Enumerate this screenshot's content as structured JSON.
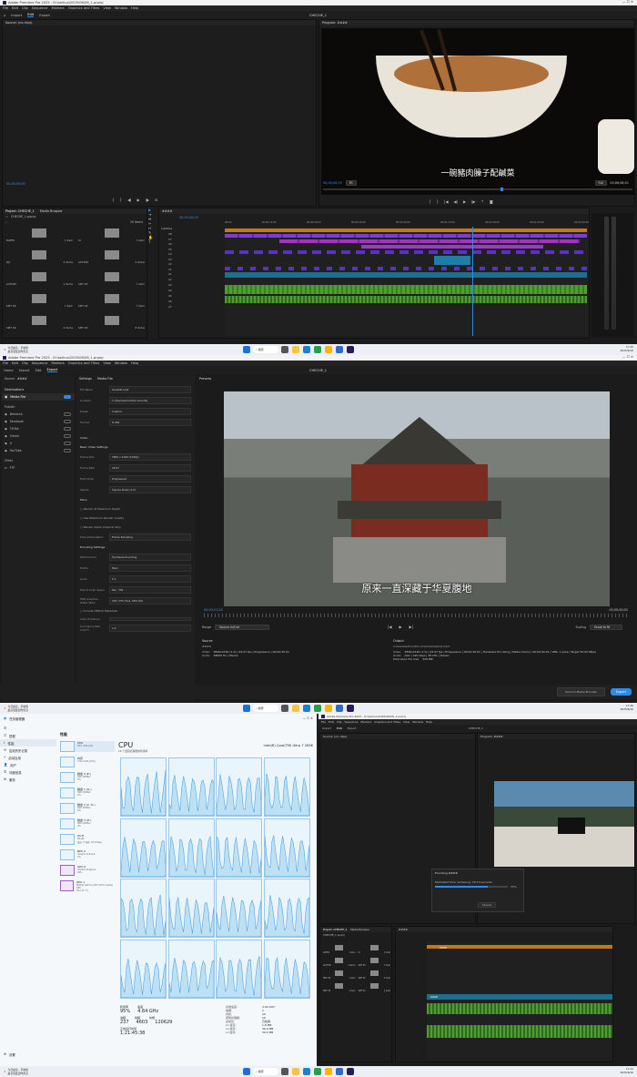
{
  "colors": {
    "accent": "#2d8ceb",
    "video": "#8a2be2",
    "audio": "#3e8f2a",
    "orange": "#c8761a"
  },
  "s1": {
    "app_title": "Adobe Premiere Pro 2025 - D:\\beihuo\\2025\\06\\06_1.prproj",
    "menu": [
      "File",
      "Edit",
      "Clip",
      "Sequence",
      "Markers",
      "Graphics and Titles",
      "View",
      "Window",
      "Help"
    ],
    "tabs": [
      "Import",
      "Edit",
      "Export"
    ],
    "center_title": "CHECHE_1",
    "source_label": "Source: (no clips)",
    "program_label": "Program: ####",
    "subtitle": "一碗豬肉臊子配鹹菜",
    "tc_left": "00;00;00;00",
    "tc_program": "00;00;40;29",
    "tc_program_end": "00;06;08;01",
    "fit": "Fit",
    "full": "Full",
    "project_tab": "Project: CHECHE_1",
    "media_browser": "Media Browser",
    "project_file": "CHECHE_1.prproj",
    "item_count": "10 Items",
    "bins": [
      [
        "DATES",
        "1 item",
        "IU",
        "1 item"
      ],
      [
        "DJI",
        "2 items",
        "ACTION",
        "2 items"
      ],
      [
        "ACTION",
        "1 items",
        "SMT 05",
        "1 item"
      ],
      [
        "SMT 06",
        "1 item",
        "SMT 04",
        "1 item"
      ],
      [
        "SMT 09",
        "2 items",
        "SMT 03",
        "8 items"
      ]
    ],
    "sequence_tab": "####",
    "tc_timeline": "00;00;40;29",
    "ruler": [
      "00;00",
      "00;00;15;00",
      "00;00;30;00",
      "00;00;45;00",
      "00;01;00;00",
      "00;01;15;00",
      "00;01;30;00",
      "00;01;45;00",
      "00;02;00;00"
    ],
    "tracks_v": [
      "V8",
      "V7",
      "V6",
      "V5",
      "V4",
      "V3",
      "V2",
      "V1"
    ],
    "tracks_a": [
      "A1",
      "A2",
      "A3",
      "A4",
      "A5",
      "A6",
      "A7"
    ],
    "subtitle_track": "Subtitles"
  },
  "taskbar1": {
    "weather": "今日最高，平常值",
    "weather2": "最高温度比昨天高",
    "search": "搜索",
    "time": "17:40",
    "date": "2025/6/16"
  },
  "s2": {
    "app_title": "Adobe Premiere Pro 2025 - D:\\beihuo\\2025\\06\\06_1.prproj",
    "menu": [
      "File",
      "Edit",
      "Clip",
      "Sequence",
      "Markers",
      "Graphics and Titles",
      "View",
      "Window",
      "Help"
    ],
    "tabs": [
      "Home",
      "Import",
      "Edit",
      "Export"
    ],
    "center_title": "CHECHE_1",
    "source": "Source",
    "source_name": "####",
    "destinations": "Destinations",
    "media_file": "Media File",
    "publish": "Publish",
    "publish_items": [
      "Behance",
      "Facebook",
      "TikTok",
      "Vimeo",
      "X",
      "YouTube"
    ],
    "other": "Other",
    "ftp": "FTP",
    "settings": "Settings",
    "media_file_title": "Media File",
    "file_name_lbl": "File Name",
    "file_name": "sheahat.mp4",
    "location_lbl": "Location",
    "location": "C:\\Users\\admin\\Documents\\",
    "preset_lbl": "Preset",
    "preset": "Custom",
    "format_lbl": "Format",
    "format": "H.264",
    "video": "Video",
    "basic_video": "Basic Video Settings",
    "match_source": "Match Source",
    "frame_size_lbl": "Frame Size",
    "frame_size": "3840 x 2160 (2160p)",
    "frame_rate_lbl": "Frame Rate",
    "frame_rate": "29.97",
    "field_order_lbl": "Field Order",
    "field_order": "Progressive",
    "aspect_lbl": "Aspect",
    "aspect": "Square Pixels (1.0)",
    "more": "More",
    "render_max_depth": "Render at Maximum Depth",
    "use_max_render": "Use Maximum Render Quality",
    "render_alpha": "Render Alpha Channel Only",
    "time_interp_lbl": "Time Interpolation",
    "time_interp": "Frame Sampling",
    "encoding_settings": "Encoding Settings",
    "performance_lbl": "Performance",
    "performance": "Hardware Encoding",
    "profile_lbl": "Profile",
    "profile": "Main",
    "level_lbl": "Level",
    "level": "5.1",
    "export_color_lbl": "Export Color Space",
    "export_color": "Rec. 709",
    "hdr_lbl": "HDR Graphics White (Nits)",
    "hdr": "203 (75% HLG, 58% PQ)",
    "include_metadata": "Include HDR10 Metadata",
    "color_primaries_lbl": "Color Primaries",
    "luminance_lbl": "Luminance Max (cd/m²)",
    "luminance": "1.0",
    "preview": "Preview",
    "subtitle": "原来一直深藏于华夏腹地",
    "tc_left": "00;00;21;28",
    "tc_right": "00;00;00;01",
    "range_lbl": "Range",
    "range": "Source In/Out",
    "scaling_lbl": "Scaling",
    "scaling": "Scale to fit",
    "source_title": "Source",
    "source_clip": "####",
    "source_video_lbl": "Video",
    "source_video": "3840x2160 (1.0) | 29.97 fps | Progressive | 00;00;30;01",
    "source_audio_lbl": "Audio",
    "source_audio": "48000 Hz | Stereo",
    "output_title": "Output",
    "output_path": "C:\\Users\\admin\\Documents\\sheahat.mp4",
    "output_video_lbl": "Video",
    "output_video": "3840x2160 (1.0) | 29.97 fps | Progressive | 00;00;30;01 | Hardware Encoding | Media Cache | 00;00;00;01 | VBR, 1 pass | Target 50.00 Mbps",
    "output_audio_lbl": "Audio",
    "output_audio": "AAC | 320 kbps | 48 kHz | Stereo",
    "est_size_lbl": "Estimated File Size",
    "est_size": "328 MB",
    "send_media_encoder": "Send to Media Encoder",
    "export_btn": "Export"
  },
  "taskbar2": {
    "weather": "今日最高，平常值",
    "weather2": "最高温度比昨天高",
    "search": "搜索",
    "time": "17:40",
    "date": "2025/6/16"
  },
  "tm": {
    "title": "任务管理器",
    "nav": [
      "进程",
      "性能",
      "应用历史记录",
      "启动应用",
      "用户",
      "详细信息",
      "服务"
    ],
    "settings": "设置",
    "perf": "性能",
    "items": [
      {
        "name": "CPU",
        "sub": "95% 4.84 GHz"
      },
      {
        "name": "内存",
        "sub": "7/31.6 GB (23%)"
      },
      {
        "name": "磁盘 0 (E:)",
        "sub": "SSD (NVMe)\n0%"
      },
      {
        "name": "磁盘 1 (G:)",
        "sub": "SSD (NVMe)\n0%"
      },
      {
        "name": "磁盘 2 (C: D:)",
        "sub": "SSD (NVMe)\n0%"
      },
      {
        "name": "磁盘 3 (H:)",
        "sub": "SSD (NVMe)\n0%"
      },
      {
        "name": "Wi-Fi",
        "sub": "WLAN\n发送: 0 接收: 18.9 Kbps"
      },
      {
        "name": "NPU 0",
        "sub": "Intel(R) AI Boost\n0%"
      },
      {
        "name": "GPU 0",
        "sub": "Intel(R) Graphics\n29%"
      },
      {
        "name": "GPU 1",
        "sub": "NVIDIA GeForce RTX 5070 Laptop GPU\n9% (41 °C)"
      }
    ],
    "cpu_title": "CPU",
    "cpu_model": "Intel(R) Core(TM) Ultra 7 265K",
    "cpu_caption": "16 个逻辑处理器的利用率",
    "util_lbl": "利用率",
    "util": "95%",
    "speed_lbl": "速度",
    "speed": "4.84 GHz",
    "proc_lbl": "进程",
    "proc": "237",
    "threads_lbl": "线程",
    "threads": "4603",
    "handles_lbl": "句柄",
    "handles": "120629",
    "uptime_lbl": "正常运行时间",
    "uptime": "1:21:45:38",
    "base_speed_lbl": "基准速度:",
    "base_speed": "3.90 GHz",
    "sockets_lbl": "插槽:",
    "sockets": "1",
    "cores_lbl": "内核:",
    "cores": "20",
    "lps_lbl": "逻辑处理器:",
    "lps": "20",
    "virt_lbl": "虚拟化:",
    "virt": "已启用",
    "l1_lbl": "L1 缓存:",
    "l1": "1.8 MB",
    "l2_lbl": "L2 缓存:",
    "l2": "36.0 MB",
    "l3_lbl": "L3 缓存:",
    "l3": "30.0 MB"
  },
  "s3": {
    "app_title": "Adobe Premiere Pro 2025 - D:\\beihuo\\2025\\06\\06_1.prproj",
    "menu": [
      "File",
      "Edit",
      "Clip",
      "Sequence",
      "Markers",
      "Graphics and Titles",
      "View",
      "Window",
      "Help"
    ],
    "tabs": [
      "Import",
      "Edit",
      "Export"
    ],
    "center_title": "CHECHE_1",
    "source_label": "Source: (no clips)",
    "program_label": "Program: ####",
    "encoding_title": "Encoding ####",
    "encoding_msg": "Estimated time remaining: 00:10 seconds",
    "encoding_pct": "72%",
    "cancel": "Cancel",
    "project_tab": "Project: CHECHE_1",
    "media_browser": "Media Browser",
    "project_file": "CHECHE_1.prproj",
    "bins": [
      [
        "DATES",
        "1 item",
        "IU",
        "1 item"
      ],
      [
        "ACTION",
        "1 items",
        "SMT 05",
        "1 item"
      ],
      [
        "SMT 06",
        "1 item",
        "SMT 04",
        "1 item"
      ],
      [
        "SMT 09",
        "1 item",
        "SMT 03",
        "1 item"
      ]
    ],
    "sequence_tab": "####",
    "clip_name": "####",
    "audio_clip": "####"
  },
  "taskbar3": {
    "weather": "今日最高，平常值",
    "weather2": "最高温度比昨天高",
    "search": "搜索",
    "time": "17:41",
    "date": "2025/6/16"
  }
}
